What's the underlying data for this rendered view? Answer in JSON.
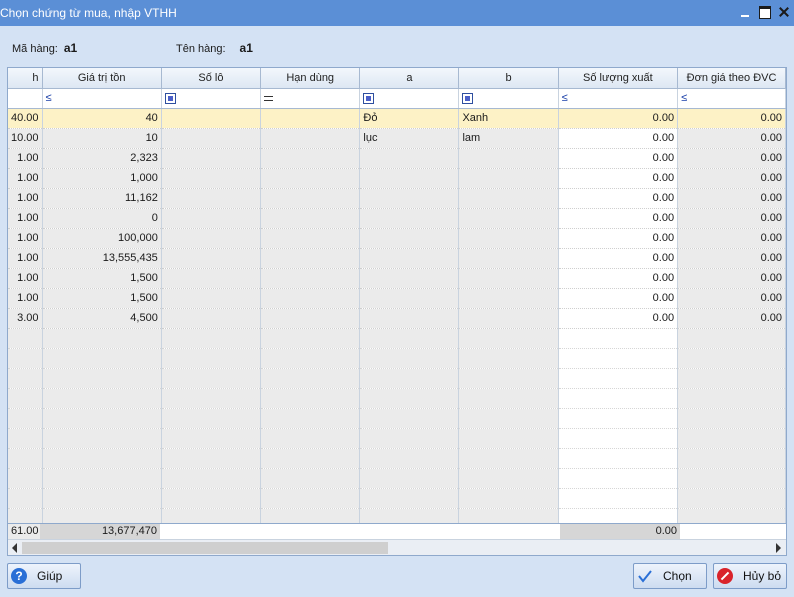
{
  "window": {
    "title": "Chọn chứng từ mua, nhập VTHH"
  },
  "info": {
    "code_label": "Mã hàng:",
    "code_value": "a1",
    "name_label": "Tên hàng:",
    "name_value": "a1"
  },
  "grid": {
    "columns": [
      {
        "key": "qty_in",
        "label": "h"
      },
      {
        "key": "value",
        "label": "Giá trị tồn"
      },
      {
        "key": "lot",
        "label": "Số lô"
      },
      {
        "key": "expiry",
        "label": "Hạn dùng"
      },
      {
        "key": "a",
        "label": "a"
      },
      {
        "key": "b",
        "label": "b"
      },
      {
        "key": "qty_out",
        "label": "Số lượng xuất"
      },
      {
        "key": "unit_price",
        "label": "Đơn giá theo ĐVC"
      }
    ],
    "filters": {
      "value": "≤",
      "qty_out": "≤",
      "unit_price": "≤"
    },
    "rows": [
      {
        "qty_in": "40.00",
        "value": "40",
        "lot": "",
        "expiry": "",
        "a": "Đỏ",
        "b": "Xanh",
        "qty_out": "0.00",
        "unit_price": "0.00"
      },
      {
        "qty_in": "10.00",
        "value": "10",
        "lot": "",
        "expiry": "",
        "a": "lục",
        "b": "lam",
        "qty_out": "0.00",
        "unit_price": "0.00"
      },
      {
        "qty_in": "1.00",
        "value": "2,323",
        "lot": "",
        "expiry": "",
        "a": "",
        "b": "",
        "qty_out": "0.00",
        "unit_price": "0.00"
      },
      {
        "qty_in": "1.00",
        "value": "1,000",
        "lot": "",
        "expiry": "",
        "a": "",
        "b": "",
        "qty_out": "0.00",
        "unit_price": "0.00"
      },
      {
        "qty_in": "1.00",
        "value": "11,162",
        "lot": "",
        "expiry": "",
        "a": "",
        "b": "",
        "qty_out": "0.00",
        "unit_price": "0.00"
      },
      {
        "qty_in": "1.00",
        "value": "0",
        "lot": "",
        "expiry": "",
        "a": "",
        "b": "",
        "qty_out": "0.00",
        "unit_price": "0.00"
      },
      {
        "qty_in": "1.00",
        "value": "100,000",
        "lot": "",
        "expiry": "",
        "a": "",
        "b": "",
        "qty_out": "0.00",
        "unit_price": "0.00"
      },
      {
        "qty_in": "1.00",
        "value": "13,555,435",
        "lot": "",
        "expiry": "",
        "a": "",
        "b": "",
        "qty_out": "0.00",
        "unit_price": "0.00"
      },
      {
        "qty_in": "1.00",
        "value": "1,500",
        "lot": "",
        "expiry": "",
        "a": "",
        "b": "",
        "qty_out": "0.00",
        "unit_price": "0.00"
      },
      {
        "qty_in": "1.00",
        "value": "1,500",
        "lot": "",
        "expiry": "",
        "a": "",
        "b": "",
        "qty_out": "0.00",
        "unit_price": "0.00"
      },
      {
        "qty_in": "3.00",
        "value": "4,500",
        "lot": "",
        "expiry": "",
        "a": "",
        "b": "",
        "qty_out": "0.00",
        "unit_price": "0.00"
      }
    ],
    "totals": {
      "qty_in": "61.00",
      "value": "13,677,470",
      "qty_out": "0.00"
    }
  },
  "buttons": {
    "help": "Giúp",
    "choose": "Chọn",
    "cancel": "Hủy bỏ"
  }
}
